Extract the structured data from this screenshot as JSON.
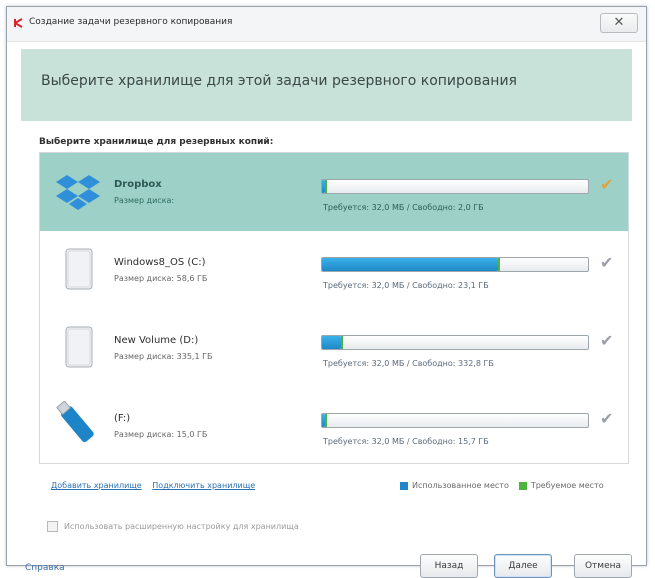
{
  "window": {
    "title": "Создание задачи резервного копирования",
    "close_label": "✕"
  },
  "header": {
    "text": "Выберите хранилище для этой задачи резервного копирования"
  },
  "section_label": "Выберите хранилище для резервных копий:",
  "storages": [
    {
      "name": "Dropbox",
      "size": "Размер диска:",
      "info": "Требуется: 32,0 МБ / Свободно: 2,0 ГБ",
      "used_fraction": 0.01,
      "selected": true,
      "icon": "dropbox-icon"
    },
    {
      "name": "Windows8_OS (C:)",
      "size": "Размер диска: 58,6 ГБ",
      "info": "Требуется: 32,0 МБ / Свободно: 23,1 ГБ",
      "used_fraction": 0.66,
      "selected": false,
      "icon": "drive-icon"
    },
    {
      "name": "New Volume (D:)",
      "size": "Размер диска: 335,1 ГБ",
      "info": "Требуется: 32,0 МБ / Свободно: 332,8 ГБ",
      "used_fraction": 0.07,
      "selected": false,
      "icon": "drive-icon"
    },
    {
      "name": "(F:)",
      "size": "Размер диска: 15,0 ГБ",
      "info": "Требуется: 32,0 МБ / Свободно: 15,7 ГБ",
      "used_fraction": 0.01,
      "selected": false,
      "icon": "usb-drive-icon"
    }
  ],
  "links": {
    "add": "Добавить хранилище",
    "connect": "Подключить хранилище"
  },
  "legend": {
    "used": "Использованное место",
    "required": "Требуемое место"
  },
  "remember_label": "Использовать расширенную настройку для хранилища",
  "footer": {
    "help": "Справка",
    "back": "Назад",
    "next": "Далее",
    "cancel": "Отмена"
  },
  "colors": {
    "selected_bg": "#9dd0c6",
    "header_band": "#c8e1d9",
    "used_bar": "#1e88c8",
    "required_marker": "#4fb43d",
    "check_active": "#e0a23a"
  }
}
